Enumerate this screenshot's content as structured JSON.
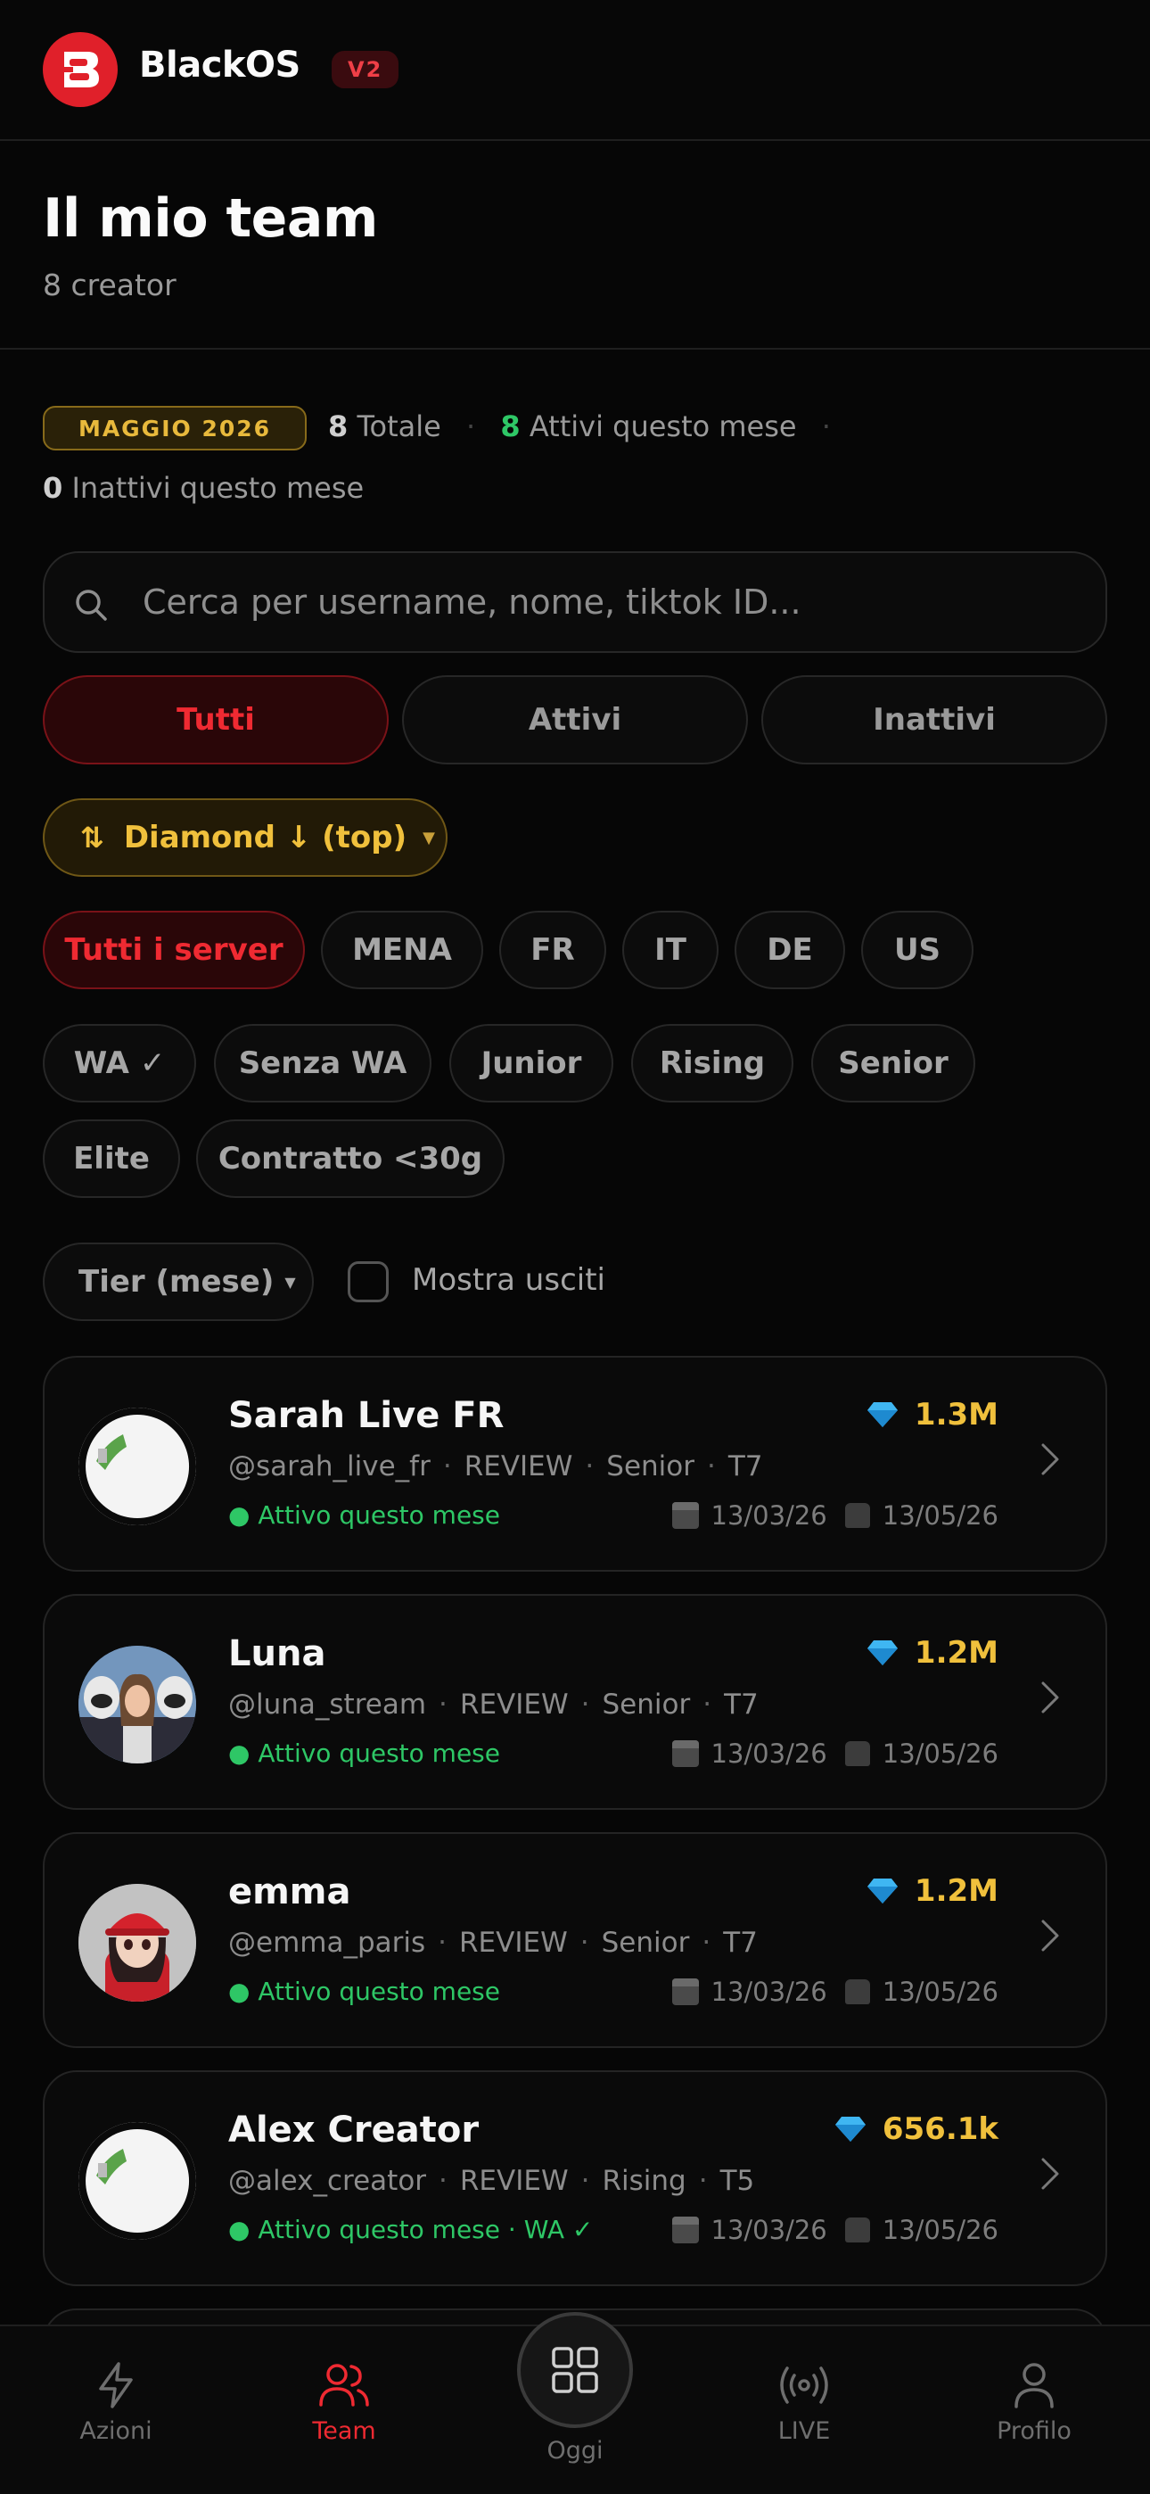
{
  "header": {
    "brand": "BlackOS",
    "version": "V2"
  },
  "page": {
    "title": "Il mio team",
    "subtitle": "8 creator"
  },
  "stats": {
    "month": "MAGGIO 2026",
    "total_value": "8",
    "total_label": "Totale",
    "active_value": "8",
    "active_label": "Attivi questo mese",
    "inactive_value": "0",
    "inactive_label": "Inattivi questo mese"
  },
  "search": {
    "placeholder": "Cerca per username, nome, tiktok ID..."
  },
  "segments": [
    "Tutti",
    "Attivi",
    "Inattivi"
  ],
  "sort": {
    "label": "Diamond ↓ (top)"
  },
  "servers": [
    "Tutti i server",
    "MENA",
    "FR",
    "IT",
    "DE",
    "US"
  ],
  "tags": [
    "WA ✓",
    "Senza WA",
    "Junior",
    "Rising",
    "Senior",
    "Elite",
    "Contratto <30g"
  ],
  "tier": {
    "label": "Tier (mese)"
  },
  "show_exited": {
    "label": "Mostra usciti",
    "checked": false
  },
  "creators": [
    {
      "name": "Sarah Live FR",
      "username": "@sarah_live_fr",
      "type": "REVIEW",
      "level": "Senior",
      "tier": "T7",
      "status": "● Attivo questo mese",
      "wa": "",
      "diamonds": "1.3M",
      "date1": "13/03/26",
      "date2": "13/05/26"
    },
    {
      "name": "Luna",
      "username": "@luna_stream",
      "type": "REVIEW",
      "level": "Senior",
      "tier": "T7",
      "status": "● Attivo questo mese",
      "wa": "",
      "diamonds": "1.2M",
      "date1": "13/03/26",
      "date2": "13/05/26"
    },
    {
      "name": "emma",
      "username": "@emma_paris",
      "type": "REVIEW",
      "level": "Senior",
      "tier": "T7",
      "status": "● Attivo questo mese",
      "wa": "",
      "diamonds": "1.2M",
      "date1": "13/03/26",
      "date2": "13/05/26"
    },
    {
      "name": "Alex Creator",
      "username": "@alex_creator",
      "type": "REVIEW",
      "level": "Rising",
      "tier": "T5",
      "status": "● Attivo questo mese",
      "wa": "· WA ✓",
      "diamonds": "656.1k",
      "date1": "13/03/26",
      "date2": "13/05/26"
    }
  ],
  "tabs": {
    "actions": "Azioni",
    "team": "Team",
    "today": "Oggi",
    "live": "LIVE",
    "profile": "Profilo"
  },
  "colors": {
    "accent": "#ef2a32",
    "gold": "#f0c03c",
    "green": "#2ec766",
    "background": "#060606"
  }
}
